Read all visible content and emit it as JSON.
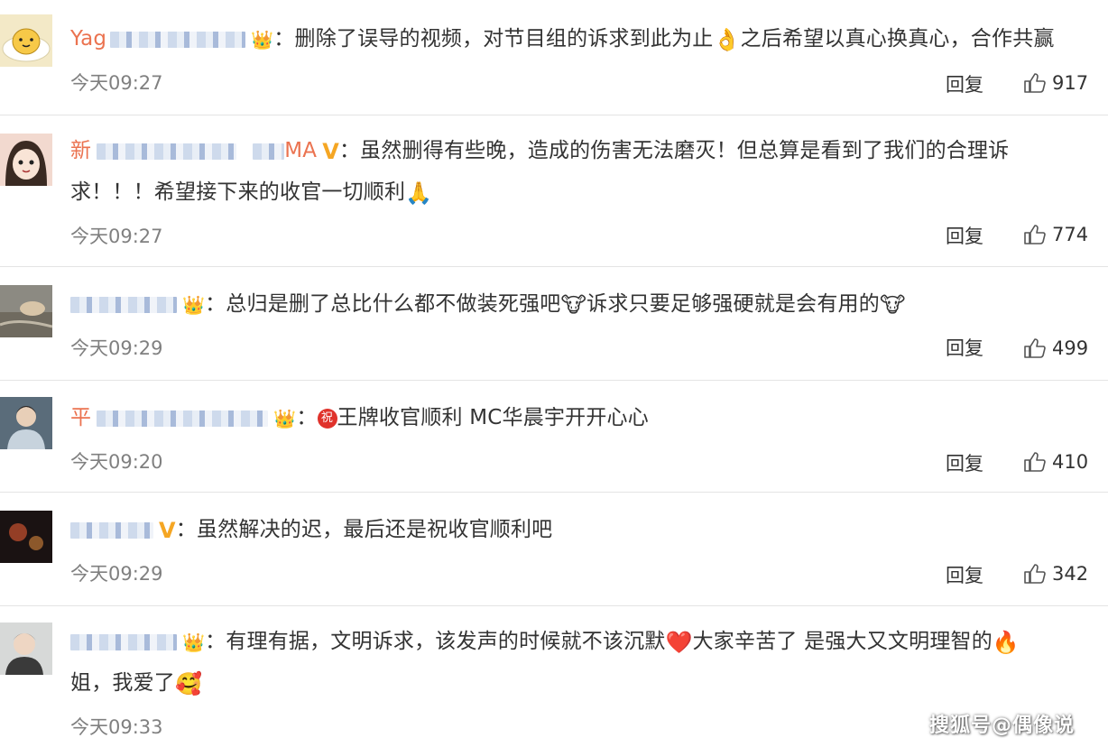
{
  "reply_label": "回复",
  "comments": [
    {
      "username_prefix": "Yag",
      "badge": "crown",
      "text_parts": [
        "：删除了误导的视频，对节目组的诉求到此为止",
        "之后希望以真心换真心，合作共赢"
      ],
      "emoji_1": "👌",
      "time": "今天09:27",
      "likes": "917"
    },
    {
      "username_prefix": "新",
      "username_suffix": "MA",
      "badge": "V",
      "text_line_1": "：虽然删得有些晚，造成的伤害无法磨灭！但总算是看到了我们的合理诉",
      "text_line_2": "求！！！希望接下来的收官一切顺利",
      "emoji_1": "🙏",
      "time": "今天09:27",
      "likes": "774"
    },
    {
      "username_prefix": "",
      "badge": "crown-small",
      "text_parts": [
        "：总归是删了总比什么都不做装死强吧",
        "诉求只要足够强硬就是会有用的"
      ],
      "emoji_1": "🐮",
      "time": "今天09:29",
      "likes": "499"
    },
    {
      "username_prefix": "平",
      "badge": "crown",
      "text_parts": [
        "：",
        "王牌收官顺利 MC华晨宇开开心心"
      ],
      "emoji_1": "祝",
      "time": "今天09:20",
      "likes": "410"
    },
    {
      "username_prefix": "",
      "badge": "V",
      "text_parts": [
        "：虽然解决的迟，最后还是祝收官顺利吧"
      ],
      "time": "今天09:29",
      "likes": "342"
    },
    {
      "username_prefix": "",
      "badge": "crown-small",
      "text_line_1_parts": [
        "：有理有据，文明诉求，该发声的时候就不该沉默",
        "大家辛苦了 是强大又文明理智的"
      ],
      "text_line_2": "姐，我爱了",
      "emoji_1": "❤️",
      "emoji_2": "🔥",
      "emoji_3": "🥰",
      "time": "今天09:33"
    }
  ],
  "watermark": "搜狐号@偶像说",
  "colors": {
    "username": "#eb7350",
    "time": "#808080",
    "divider": "#e4e4e4",
    "text": "#333333"
  }
}
